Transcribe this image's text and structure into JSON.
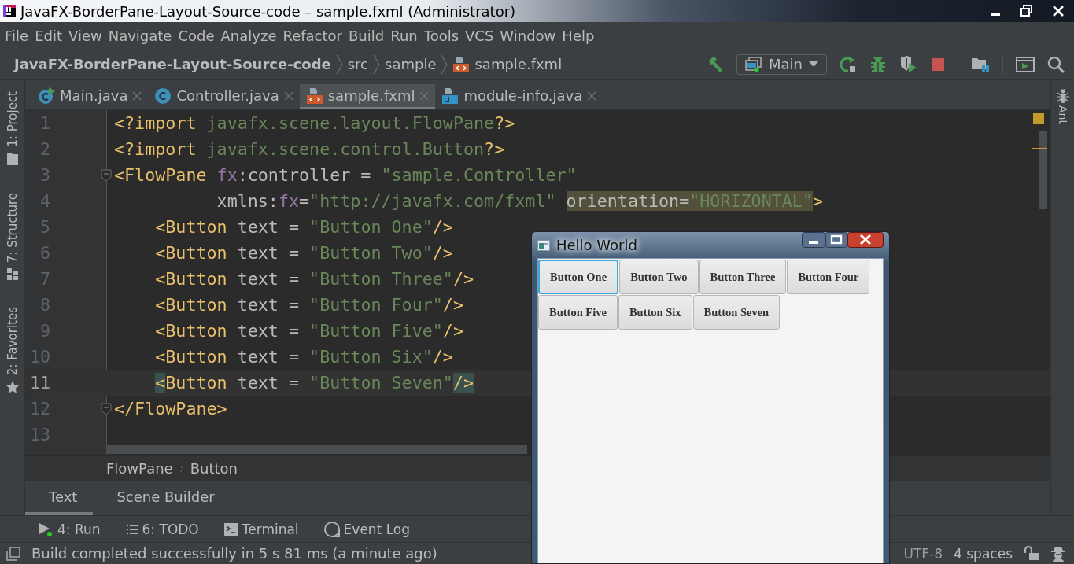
{
  "window": {
    "title": "JavaFX-BorderPane-Layout-Source-code – sample.fxml (Administrator)"
  },
  "menu": [
    "File",
    "Edit",
    "View",
    "Navigate",
    "Code",
    "Analyze",
    "Refactor",
    "Build",
    "Run",
    "Tools",
    "VCS",
    "Window",
    "Help"
  ],
  "breadcrumb": [
    {
      "label": "JavaFX-BorderPane-Layout-Source-code",
      "kind": "project"
    },
    {
      "label": "src",
      "kind": "folder"
    },
    {
      "label": "sample",
      "kind": "folder"
    },
    {
      "label": "sample.fxml",
      "kind": "fxml"
    }
  ],
  "run_config": {
    "label": "Main"
  },
  "left_stripe": [
    {
      "label": "1: Project",
      "kind": "folder"
    },
    {
      "label": "7: Structure",
      "kind": "structure"
    },
    {
      "label": "2: Favorites",
      "kind": "star"
    }
  ],
  "right_stripe": [
    {
      "label": "Ant"
    }
  ],
  "tabs": [
    {
      "label": "Main.java",
      "kind": "class-run",
      "selected": false
    },
    {
      "label": "Controller.java",
      "kind": "class",
      "selected": false
    },
    {
      "label": "sample.fxml",
      "kind": "fxml",
      "selected": true
    },
    {
      "label": "module-info.java",
      "kind": "module",
      "selected": false
    }
  ],
  "editor": {
    "lines": [
      {
        "number": "1",
        "current": false,
        "fold": false,
        "segments": [
          {
            "kind": "tag",
            "text": "<?import"
          },
          {
            "kind": "value",
            "text": " javafx.scene.layout.FlowPane"
          },
          {
            "kind": "tag",
            "text": "?>"
          }
        ]
      },
      {
        "number": "2",
        "current": false,
        "fold": false,
        "segments": [
          {
            "kind": "tag",
            "text": "<?import"
          },
          {
            "kind": "value",
            "text": " javafx.scene.control.Button"
          },
          {
            "kind": "tag",
            "text": "?>"
          }
        ]
      },
      {
        "number": "3",
        "current": false,
        "fold": true,
        "segments": [
          {
            "kind": "tag",
            "text": "<FlowPane"
          },
          {
            "kind": "ns",
            "text": " fx"
          },
          {
            "kind": "text",
            "text": ":controller = "
          },
          {
            "kind": "value",
            "text": "\"sample.Controller\""
          }
        ]
      },
      {
        "number": "4",
        "current": false,
        "fold": false,
        "segments": [
          {
            "kind": "text",
            "text": "          xmlns:"
          },
          {
            "kind": "ns",
            "text": "fx"
          },
          {
            "kind": "text",
            "text": "="
          },
          {
            "kind": "value",
            "text": "\"http://javafx.com/fxml\" "
          },
          {
            "kind": "text",
            "text": "orientation",
            "usage_highlight": true
          },
          {
            "kind": "text",
            "text": "=",
            "usage_highlight": true
          },
          {
            "kind": "value",
            "text": "\"HORIZONTAL\"",
            "usage_highlight": true
          },
          {
            "kind": "tag",
            "text": ">"
          }
        ]
      },
      {
        "number": "5",
        "current": false,
        "fold": false,
        "segments": [
          {
            "kind": "tag",
            "text": "    <Button"
          },
          {
            "kind": "text",
            "text": " text = "
          },
          {
            "kind": "value",
            "text": "\"Button One\""
          },
          {
            "kind": "tag",
            "text": "/>"
          }
        ]
      },
      {
        "number": "6",
        "current": false,
        "fold": false,
        "segments": [
          {
            "kind": "tag",
            "text": "    <Button"
          },
          {
            "kind": "text",
            "text": " text = "
          },
          {
            "kind": "value",
            "text": "\"Button Two\""
          },
          {
            "kind": "tag",
            "text": "/>"
          }
        ]
      },
      {
        "number": "7",
        "current": false,
        "fold": false,
        "segments": [
          {
            "kind": "tag",
            "text": "    <Button"
          },
          {
            "kind": "text",
            "text": " text = "
          },
          {
            "kind": "value",
            "text": "\"Button Three\""
          },
          {
            "kind": "tag",
            "text": "/>"
          }
        ]
      },
      {
        "number": "8",
        "current": false,
        "fold": false,
        "segments": [
          {
            "kind": "tag",
            "text": "    <Button"
          },
          {
            "kind": "text",
            "text": " text = "
          },
          {
            "kind": "value",
            "text": "\"Button Four\""
          },
          {
            "kind": "tag",
            "text": "/>"
          }
        ]
      },
      {
        "number": "9",
        "current": false,
        "fold": false,
        "segments": [
          {
            "kind": "tag",
            "text": "    <Button"
          },
          {
            "kind": "text",
            "text": " text = "
          },
          {
            "kind": "value",
            "text": "\"Button Five\""
          },
          {
            "kind": "tag",
            "text": "/>"
          }
        ]
      },
      {
        "number": "10",
        "current": false,
        "fold": false,
        "segments": [
          {
            "kind": "tag",
            "text": "    <Button"
          },
          {
            "kind": "text",
            "text": " text = "
          },
          {
            "kind": "value",
            "text": "\"Button Six\""
          },
          {
            "kind": "tag",
            "text": "/>"
          }
        ]
      },
      {
        "number": "11",
        "current": true,
        "fold": false,
        "segments": [
          {
            "kind": "tag",
            "text": "    <",
            "brace_match": true
          },
          {
            "kind": "tag",
            "text": "Button"
          },
          {
            "kind": "text",
            "text": " text = "
          },
          {
            "kind": "value",
            "text": "\"Button Seven\""
          },
          {
            "kind": "tag",
            "text": "/>",
            "brace_match": true
          }
        ]
      },
      {
        "number": "12",
        "current": false,
        "fold": true,
        "segments": [
          {
            "kind": "tag",
            "text": "</FlowPane>"
          }
        ]
      },
      {
        "number": "13",
        "current": false,
        "fold": false
      }
    ]
  },
  "path": [
    "FlowPane",
    "Button"
  ],
  "editor_tabs": [
    {
      "label": "Text",
      "selected": true
    },
    {
      "label": "Scene Builder",
      "selected": false
    }
  ],
  "tool_windows": [
    {
      "label": "4: Run",
      "kind": "run"
    },
    {
      "label": "6: TODO",
      "kind": "todo"
    },
    {
      "label": "Terminal",
      "kind": "terminal"
    },
    {
      "label": "Event Log",
      "kind": "log"
    }
  ],
  "status": {
    "message": "Build completed successfully in 5 s 81 ms (a minute ago)",
    "encoding": "UTF-8",
    "indent": "4 spaces"
  },
  "app_window": {
    "title": "Hello World",
    "buttons": [
      {
        "label": "Button One",
        "focused": true
      },
      {
        "label": "Button Two",
        "focused": false
      },
      {
        "label": "Button Three",
        "focused": false
      },
      {
        "label": "Button Four",
        "focused": false
      },
      {
        "label": "Button Five",
        "focused": false
      },
      {
        "label": "Button Six",
        "focused": false
      },
      {
        "label": "Button Seven",
        "focused": false
      }
    ]
  }
}
